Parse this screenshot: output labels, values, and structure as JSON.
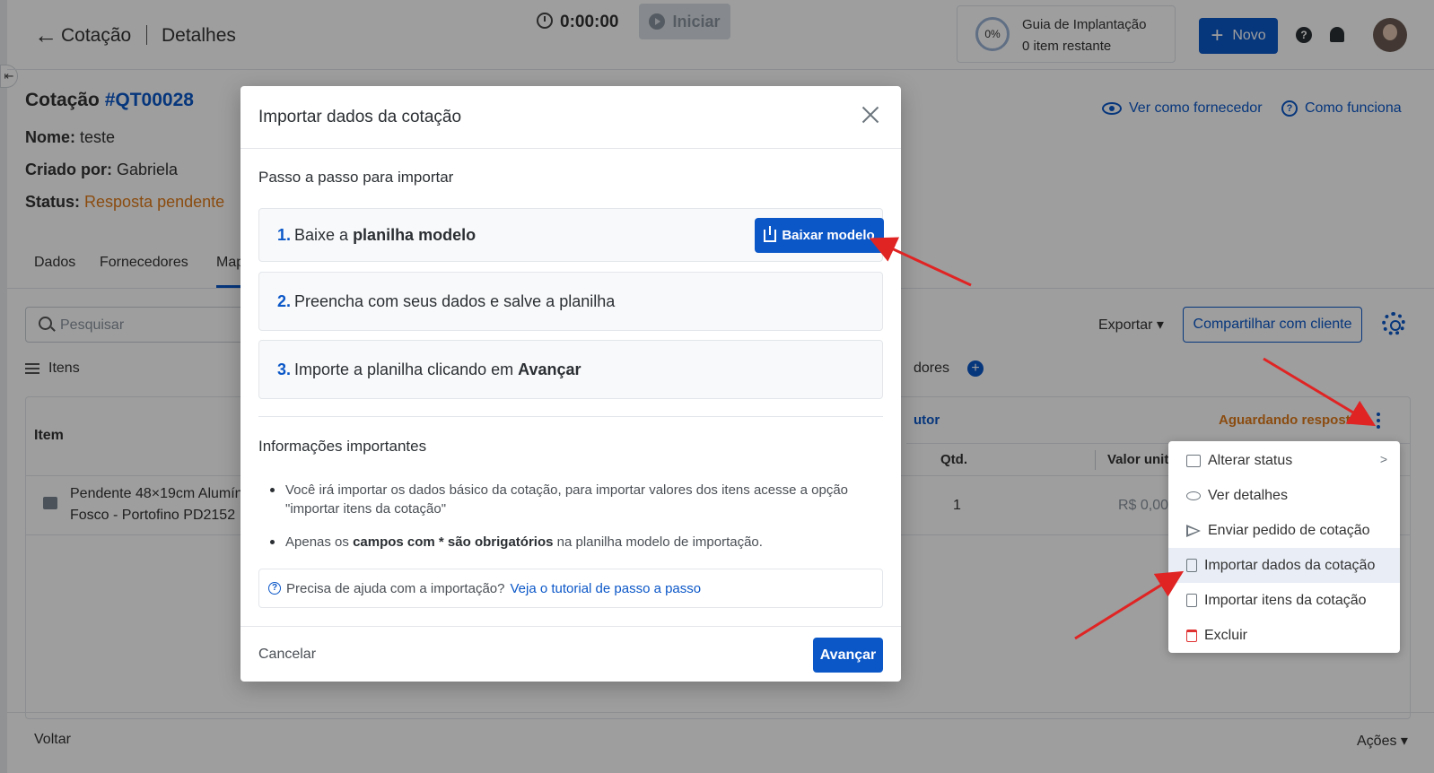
{
  "header": {
    "back_icon": "arrow-left-icon",
    "crumb_1": "Cotação",
    "crumb_2": "Detalhes",
    "timer": "0:00:00",
    "start_label": "Iniciar",
    "guide_percent": "0%",
    "guide_title": "Guia de Implantação",
    "guide_sub": "0 item restante",
    "new_label": "Novo"
  },
  "quote": {
    "title_prefix": "Cotação ",
    "code": "#QT00028",
    "name_label": "Nome:",
    "name_value": "teste",
    "creator_label": "Criado por:",
    "creator_value": "Gabriela",
    "status_label": "Status:",
    "status_value": "Resposta pendente",
    "view_as_supplier": "Ver como fornecedor",
    "how_it_works": "Como funciona"
  },
  "tabs": [
    "Dados",
    "Fornecedores",
    "Map"
  ],
  "toolbar": {
    "search_placeholder": "Pesquisar",
    "items_label": "Itens",
    "export_label": "Exportar",
    "share_label": "Compartilhar com cliente",
    "suppliers_fragment": "dores"
  },
  "table": {
    "col_item": "Item",
    "col_supplier_fragment": "utor",
    "waiting_status": "Aguardando resposta",
    "col_qty": "Qtd.",
    "col_unit_value": "Valor unit.",
    "row": {
      "product_line_1": "Pendente 48×19cm Alumín",
      "product_line_2": "Fosco - Portofino PD2152",
      "qty": "1",
      "unit_value": "R$ 0,00"
    }
  },
  "footer": {
    "back_label": "Voltar",
    "actions_label": "Ações"
  },
  "menu": {
    "items": [
      {
        "label": "Alterar status",
        "icon": "status-icon"
      },
      {
        "label": "Ver detalhes",
        "icon": "eye-icon"
      },
      {
        "label": "Enviar pedido de cotação",
        "icon": "send-icon"
      },
      {
        "label": "Importar dados da cotação",
        "icon": "file-import-icon"
      },
      {
        "label": "Importar itens da cotação",
        "icon": "file-import-icon"
      },
      {
        "label": "Excluir",
        "icon": "trash-icon"
      }
    ]
  },
  "modal": {
    "title": "Importar dados da cotação",
    "steps_title": "Passo a passo para importar",
    "step1_num": "1.",
    "step1_text": "Baixe a ",
    "step1_bold": "planilha modelo",
    "download_label": "Baixar modelo",
    "step2_num": "2.",
    "step2_text": "Preencha com seus dados e salve a planilha",
    "step3_num": "3.",
    "step3_text": "Importe a planilha clicando em ",
    "step3_bold": "Avançar",
    "info_title": "Informações importantes",
    "bullet1": "Você irá importar os dados básico da cotação, para importar valores dos itens acesse a opção \"importar itens da cotação\"",
    "bullet2_pre": "Apenas os ",
    "bullet2_bold": "campos com * são obrigatórios",
    "bullet2_post": " na planilha modelo de importação.",
    "help_text": "Precisa de ajuda com a importação?",
    "help_link": "Veja o tutorial de passo a passo",
    "cancel_label": "Cancelar",
    "next_label": "Avançar"
  },
  "colors": {
    "primary": "#0b57c8",
    "pending": "#e07b1a",
    "arrow": "#e02424"
  }
}
